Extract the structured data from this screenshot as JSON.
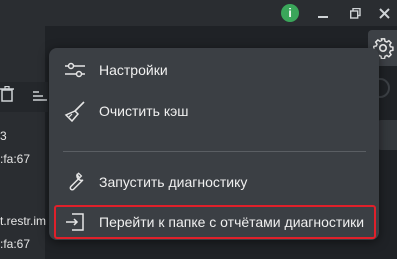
{
  "window": {
    "info_icon": "i",
    "minimize_icon": "minimize-icon",
    "maximize_icon": "restore-icon",
    "close_icon": "close-icon"
  },
  "background": {
    "line1": "3",
    "line2": ":fa:67",
    "line3": "t.restr.im",
    "line4": ":fa:67"
  },
  "menu": {
    "items": [
      {
        "label": "Настройки",
        "icon": "sliders-icon"
      },
      {
        "label": "Очистить кэш",
        "icon": "broom-icon"
      },
      {
        "label": "Запустить диагностику",
        "icon": "wrench-icon"
      },
      {
        "label": "Перейти к папке с отчётами диагностики",
        "icon": "folder-export-icon"
      }
    ]
  },
  "colors": {
    "accent_highlight": "#e0202a",
    "menu_bg": "#3b3f44",
    "app_bg": "#1f2226",
    "info_green": "#3aa65a"
  }
}
